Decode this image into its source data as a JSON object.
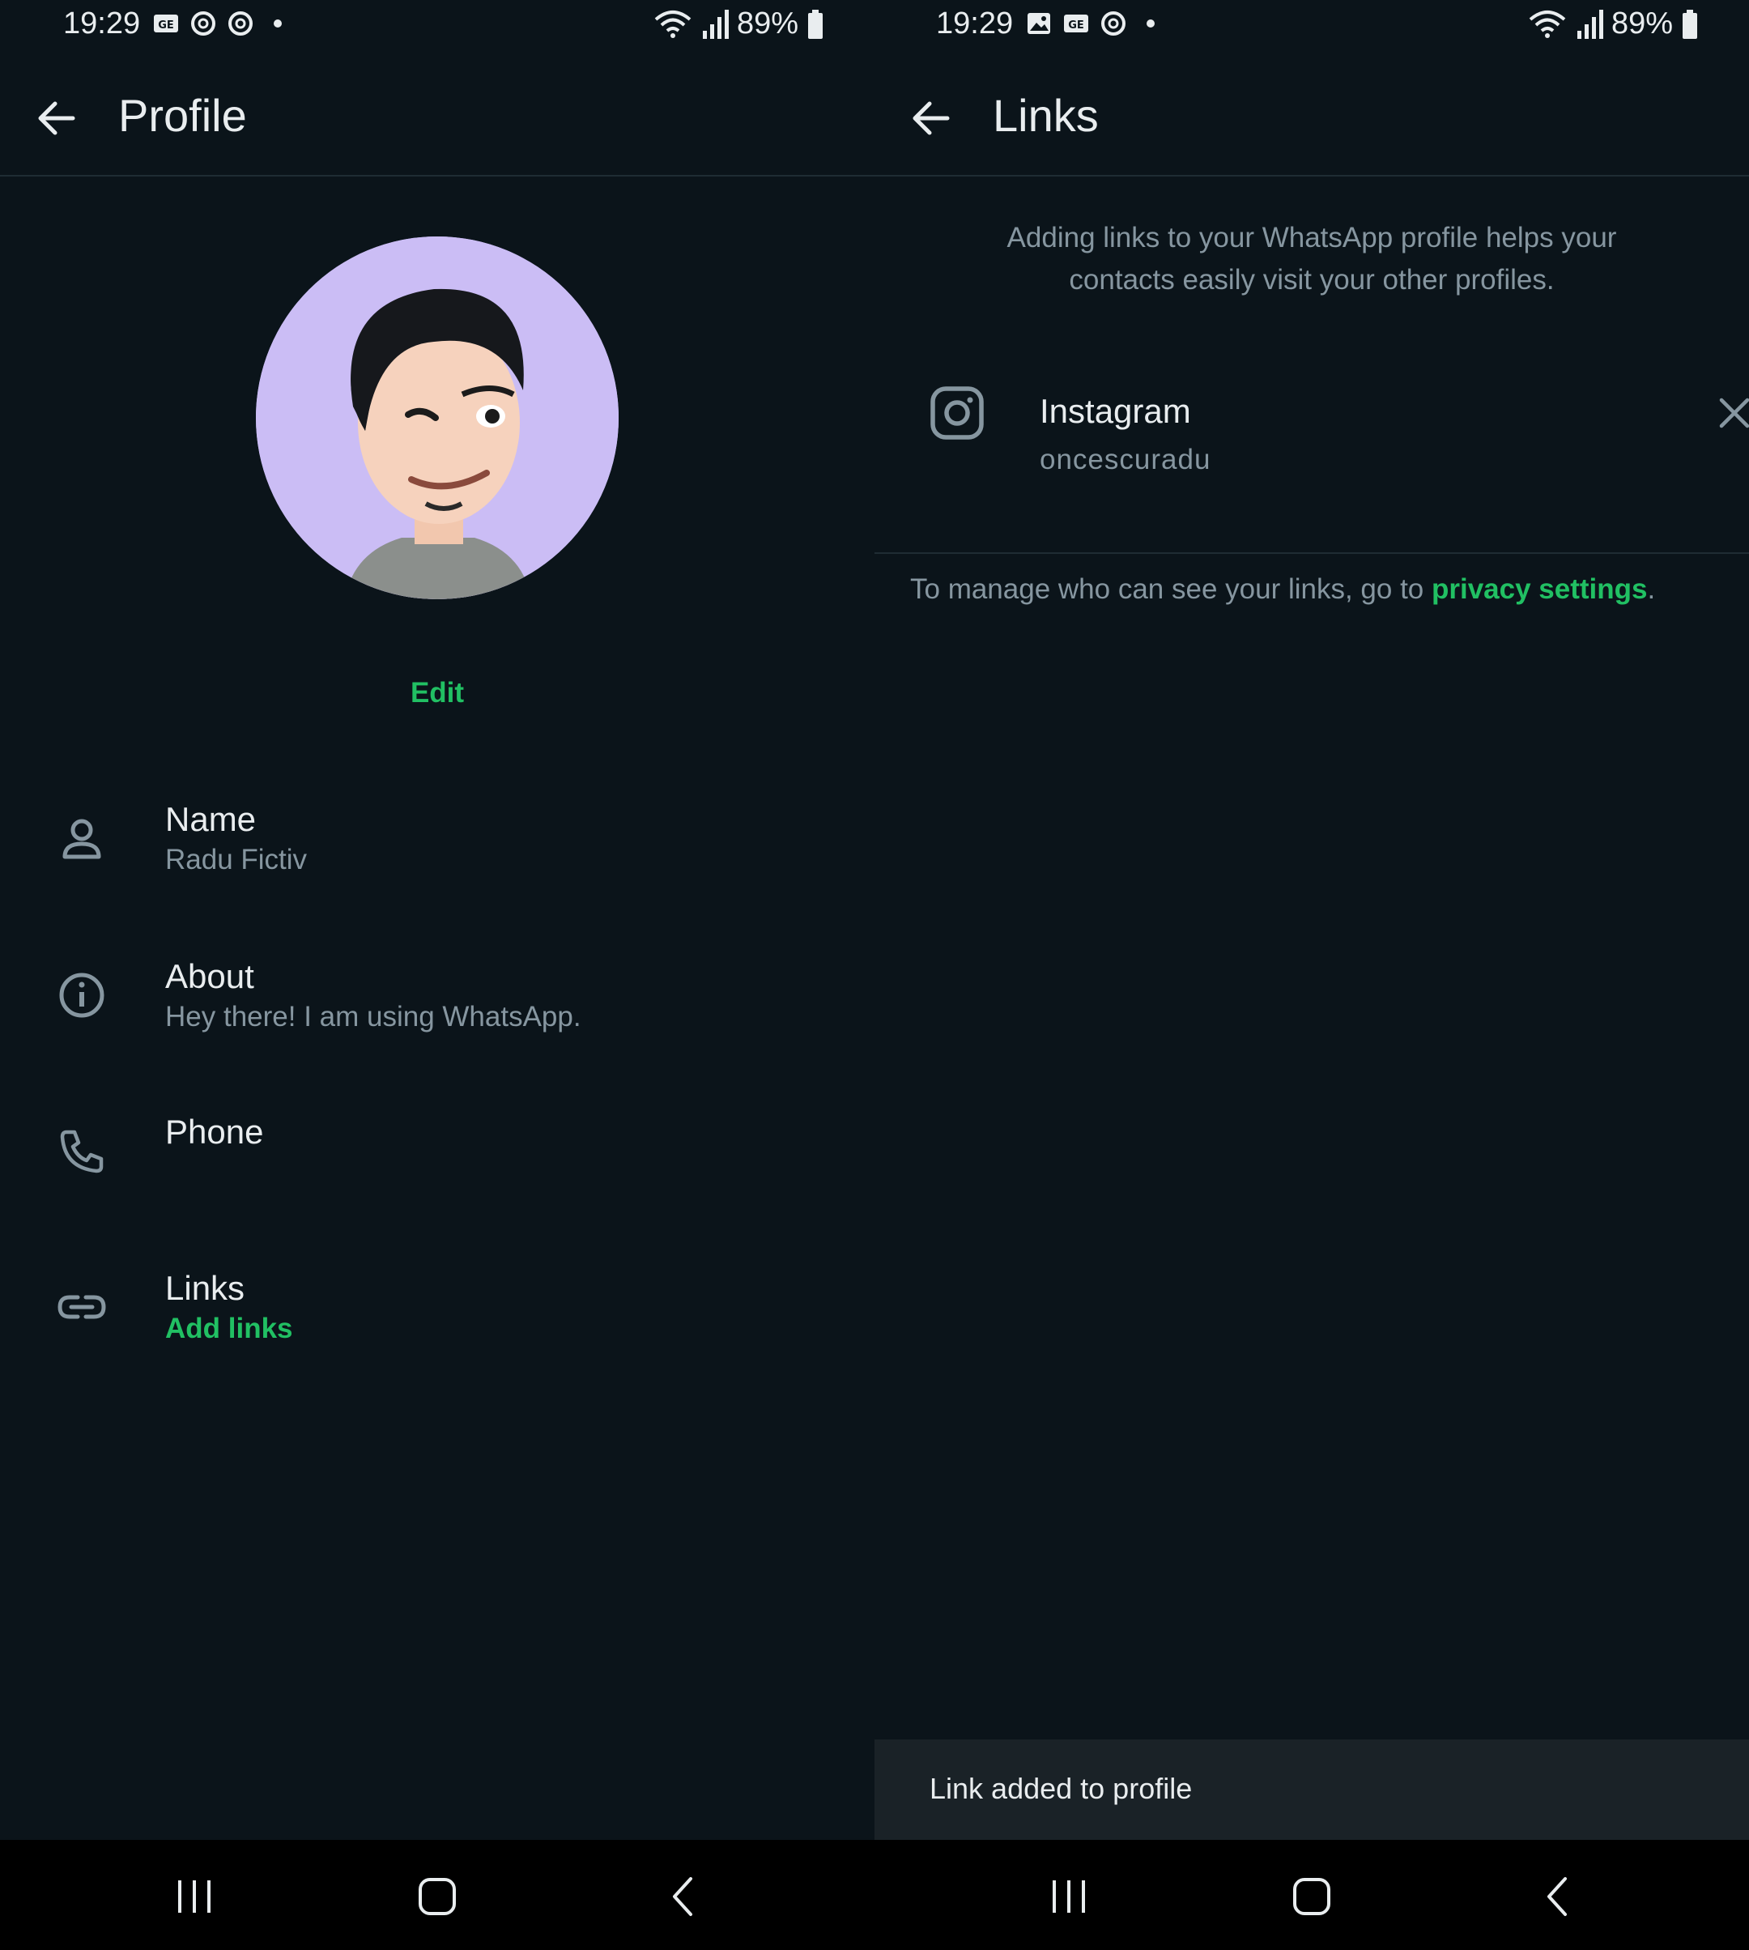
{
  "left": {
    "status": {
      "time": "19:29",
      "battery": "89%"
    },
    "title": "Profile",
    "edit_label": "Edit",
    "rows": [
      {
        "title": "Name",
        "sub": "Radu Fictiv",
        "icon": "person-icon"
      },
      {
        "title": "About",
        "sub": "Hey there! I am using WhatsApp.",
        "icon": "info-icon"
      },
      {
        "title": "Phone",
        "sub": "",
        "icon": "phone-icon"
      },
      {
        "title": "Links",
        "sub": "Add links",
        "icon": "link-icon"
      }
    ]
  },
  "right": {
    "status": {
      "time": "19:29",
      "battery": "89%"
    },
    "title": "Links",
    "intro": "Adding links to your WhatsApp profile helps your contacts easily visit your other profiles.",
    "link": {
      "name": "Instagram",
      "value": "oncescuradu",
      "icon": "instagram-icon"
    },
    "manage_prefix": "To manage who can see your links, go to ",
    "manage_link": "privacy settings",
    "manage_suffix": ".",
    "snackbar": "Link added to profile"
  },
  "colors": {
    "background": "#0b141a",
    "accent": "#21c063",
    "secondary_text": "#8696a0",
    "avatar_bg": "#cbbdf5"
  }
}
